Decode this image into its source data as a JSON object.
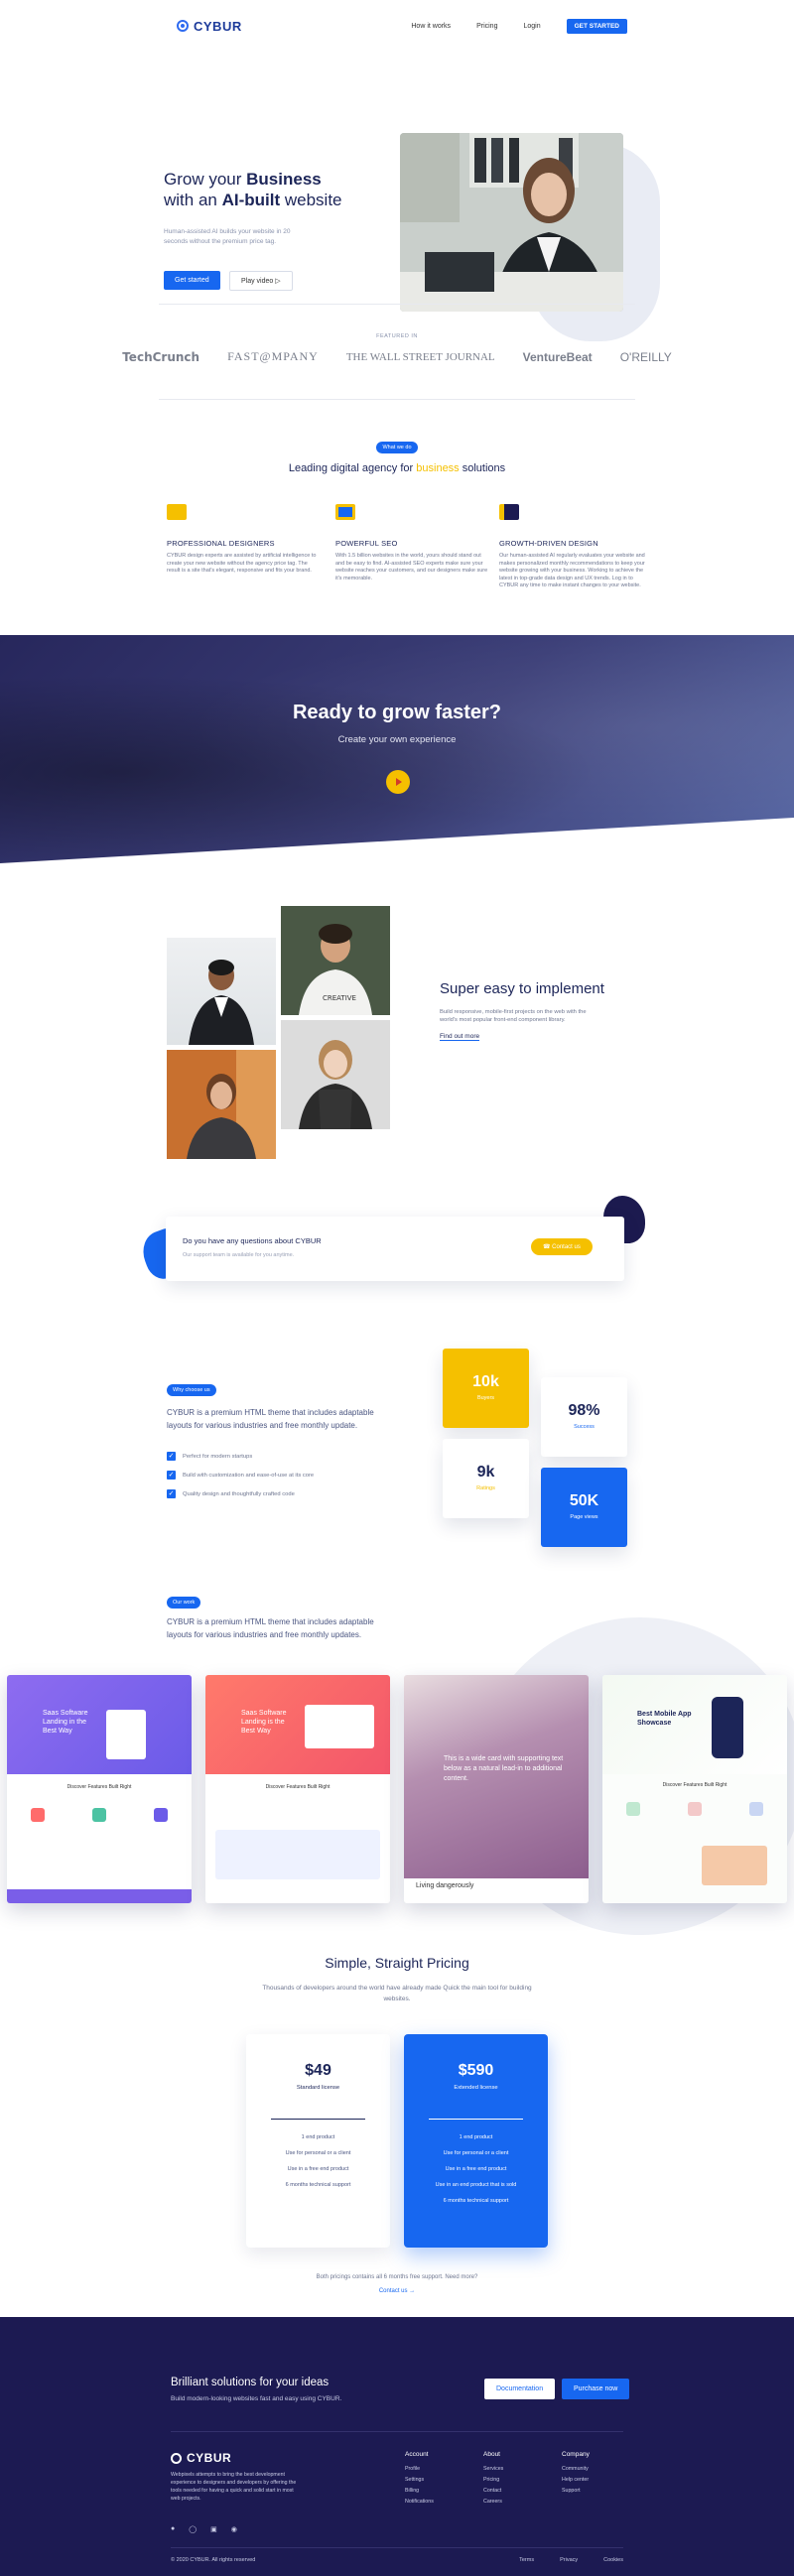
{
  "header": {
    "logo": "CYBUR",
    "nav": [
      "How it works",
      "Pricing",
      "Login"
    ],
    "cta": "GET STARTED"
  },
  "hero": {
    "title_pre": "Grow your ",
    "title_b1": "Business",
    "title_mid": "with an ",
    "title_b2": "AI-built",
    "title_post": " website",
    "desc": "Human-assisted AI builds your website in 20 seconds without the premium price tag.",
    "btn_primary": "Get started",
    "btn_secondary": "Play video"
  },
  "featured": {
    "label": "FEATURED IN",
    "logos": [
      "TechCrunch",
      "FAST@MPANY",
      "THE WALL STREET JOURNAL",
      "VentureBeat",
      "O'REILLY"
    ]
  },
  "what_we_do": {
    "pill": "What we do",
    "title_pre": "Leading digital agency for ",
    "title_y": "business",
    "title_post": " solutions",
    "items": [
      {
        "title": "PROFESSIONAL DESIGNERS",
        "text": "CYBUR design experts are assisted by artificial intelligence to create your new website without the agency price tag. The result is a site that's elegant, responsive and fits your brand."
      },
      {
        "title": "POWERFUL SEO",
        "text": "With 1.5 billion websites in the world, yours should stand out and be easy to find. AI-assisted SEO experts make sure your website reaches your customers, and our designers make sure it's memorable."
      },
      {
        "title": "GROWTH-DRIVEN DESIGN",
        "text": "Our human-assisted AI regularly evaluates your website and makes personalized monthly recommendations to keep your website growing with your business. Working to achieve the latest in top-grade data design and UX trends. Log in to CYBUR any time to make instant changes to your website."
      }
    ]
  },
  "banner": {
    "title": "Ready to grow faster?",
    "sub": "Create your own experience"
  },
  "super": {
    "title": "Super easy to implement",
    "text": "Build responsive, mobile-first projects on the web with the world's most popular front-end component library.",
    "link": "Find out more"
  },
  "question": {
    "title": "Do you have any questions about CYBUR",
    "sub": "Our support team is available for you anytime.",
    "btn": "Contact us"
  },
  "why": {
    "pill": "Why choose us",
    "text": "CYBUR is a premium HTML theme that includes adaptable layouts for various industries and free monthly update.",
    "items": [
      "Perfect for modern startups",
      "Build with customization and ease-of-use at its core",
      "Quality design and thoughtfully crafted code"
    ]
  },
  "stats": [
    {
      "value": "10k",
      "label": "Buyers"
    },
    {
      "value": "98%",
      "label": "Success"
    },
    {
      "value": "9k",
      "label": "Ratings"
    },
    {
      "value": "50K",
      "label": "Page views"
    }
  ],
  "work": {
    "pill": "Our work",
    "text": "CYBUR is a premium HTML theme that includes adaptable layouts for various industries and free monthly updates.",
    "shots": [
      {
        "title": "Saas Software Landing in the Best Way",
        "sub": "Discover Features Built Right"
      },
      {
        "title": "Saas Software Landing is the Best Way",
        "sub": "Discover Features Built Right"
      },
      {
        "title": "This is a wide card with supporting text below as a natural lead-in to additional content.",
        "sub": "Living dangerously"
      },
      {
        "title": "Best Mobile App Showcase",
        "sub": "Discover Features Built Right"
      }
    ]
  },
  "pricing": {
    "title": "Simple, Straight Pricing",
    "text": "Thousands of developers around the world have already made Quick the main tool for building websites.",
    "plans": [
      {
        "price": "$49",
        "name": "Standard license",
        "features": [
          "1 end product",
          "Use for personal or a client",
          "Use in a free end product",
          "6 months technical support"
        ]
      },
      {
        "price": "$590",
        "name": "Extended license",
        "features": [
          "1 end product",
          "Use for personal or a client",
          "Use in a free end product",
          "Use in an end product that is sold",
          "6 months technical support"
        ]
      }
    ],
    "note": "Both pricings contains all 6 months free support. Need more?",
    "contact": "Contact us"
  },
  "footer": {
    "title": "Brilliant solutions for your ideas",
    "sub": "Build modern-looking websites fast and easy using CYBUR.",
    "btn_doc": "Documentation",
    "btn_buy": "Purchase now",
    "logo": "CYBUR",
    "desc": "Webpixels attempts to bring the best development experience to designers and developers by offering the tools needed for having a quick and solid start in most web projects.",
    "cols": [
      {
        "title": "Account",
        "links": [
          "Profile",
          "Settings",
          "Billing",
          "Notifications"
        ]
      },
      {
        "title": "About",
        "links": [
          "Services",
          "Pricing",
          "Contact",
          "Careers"
        ]
      },
      {
        "title": "Company",
        "links": [
          "Community",
          "Help center",
          "Support"
        ]
      }
    ],
    "copyright": "© 2020 CYBUR. All rights reserved",
    "legal": [
      "Terms",
      "Privacy",
      "Cookies"
    ]
  },
  "colors": {
    "primary": "#1767f0",
    "accent": "#f5c000",
    "dark": "#1c1a52"
  }
}
